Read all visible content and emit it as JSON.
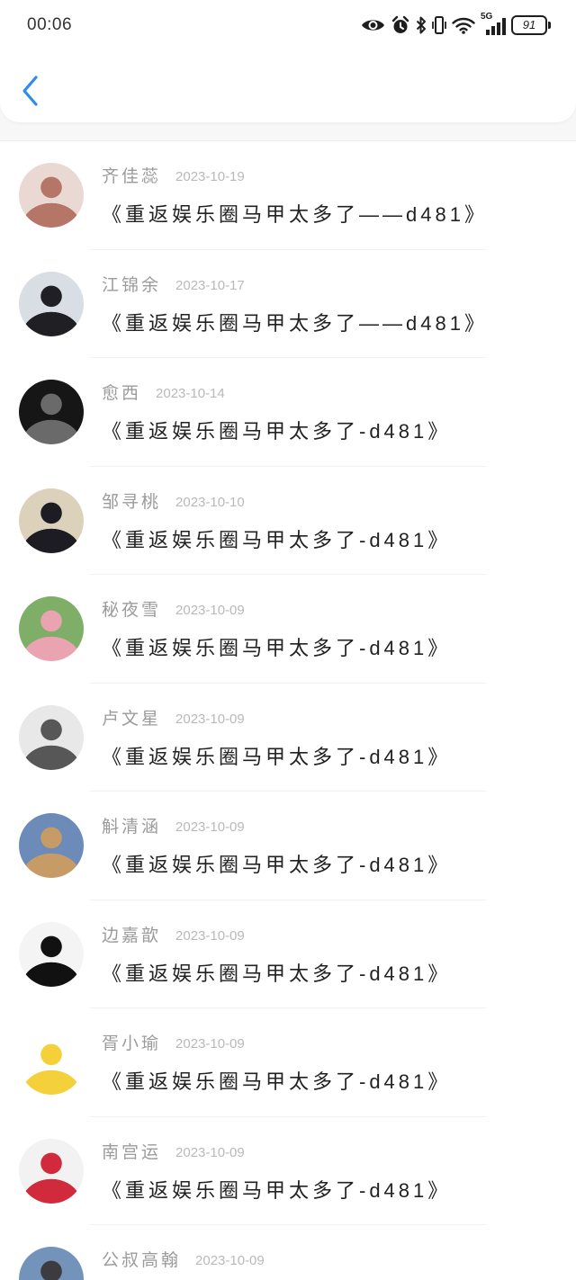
{
  "status_bar": {
    "time": "00:06",
    "network": "5G",
    "battery": "91",
    "icons": [
      "eye-icon",
      "alarm-icon",
      "bluetooth-icon",
      "vibrate-icon",
      "wifi-icon",
      "signal-bars-icon",
      "battery-icon"
    ]
  },
  "header": {
    "back_icon": "chevron-left-icon",
    "accent_color": "#2d8cf0"
  },
  "comments": [
    {
      "name": "齐佳蕊",
      "date": "2023-10-19",
      "title": "《重返娱乐圈马甲太多了——d481》",
      "avatar": {
        "bg": "#ead9d3",
        "figure": "#b57668"
      }
    },
    {
      "name": "江锦余",
      "date": "2023-10-17",
      "title": "《重返娱乐圈马甲太多了——d481》",
      "avatar": {
        "bg": "#d9dee4",
        "figure": "#1f1f24"
      }
    },
    {
      "name": "愈西",
      "date": "2023-10-14",
      "title": "《重返娱乐圈马甲太多了-d481》",
      "avatar": {
        "bg": "#161616",
        "figure": "#6a6a6a"
      }
    },
    {
      "name": "邹寻桃",
      "date": "2023-10-10",
      "title": "《重返娱乐圈马甲太多了-d481》",
      "avatar": {
        "bg": "#dcd2bb",
        "figure": "#1c1c22"
      }
    },
    {
      "name": "秘夜雪",
      "date": "2023-10-09",
      "title": "《重返娱乐圈马甲太多了-d481》",
      "avatar": {
        "bg": "#7fae68",
        "figure": "#e9a3b1"
      }
    },
    {
      "name": "卢文星",
      "date": "2023-10-09",
      "title": "《重返娱乐圈马甲太多了-d481》",
      "avatar": {
        "bg": "#e8e8e8",
        "figure": "#575757"
      }
    },
    {
      "name": "斛清涵",
      "date": "2023-10-09",
      "title": "《重返娱乐圈马甲太多了-d481》",
      "avatar": {
        "bg": "#6d8bb8",
        "figure": "#c69b66"
      }
    },
    {
      "name": "边嘉歆",
      "date": "2023-10-09",
      "title": "《重返娱乐圈马甲太多了-d481》",
      "avatar": {
        "bg": "#f4f4f4",
        "figure": "#111111"
      }
    },
    {
      "name": "胥小瑜",
      "date": "2023-10-09",
      "title": "《重返娱乐圈马甲太多了-d481》",
      "avatar": {
        "bg": "#ffffff",
        "figure": "#f4d13a"
      }
    },
    {
      "name": "南宫运",
      "date": "2023-10-09",
      "title": "《重返娱乐圈马甲太多了-d481》",
      "avatar": {
        "bg": "#f2f2f2",
        "figure": "#d12a3c"
      }
    },
    {
      "name": "公叔高翰",
      "date": "2023-10-09",
      "avatar": {
        "bg": "#7393bb",
        "figure": "#3b3b40"
      }
    }
  ]
}
